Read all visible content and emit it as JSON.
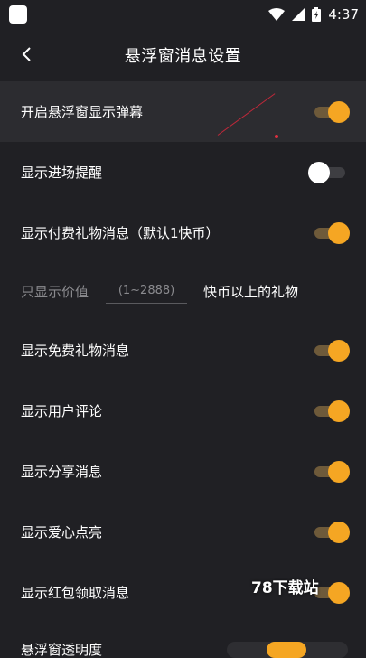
{
  "status_bar": {
    "time": "4:37"
  },
  "header": {
    "title": "悬浮窗消息设置"
  },
  "settings": [
    {
      "label": "开启悬浮窗显示弹幕",
      "on": true
    },
    {
      "label": "显示进场提醒",
      "on": false
    },
    {
      "label": "显示付费礼物消息（默认1快币）",
      "on": true
    }
  ],
  "value_filter": {
    "prefix": "只显示价值",
    "placeholder": "(1~2888)",
    "suffix": "快币以上的礼物"
  },
  "settings_more": [
    {
      "label": "显示免费礼物消息",
      "on": true
    },
    {
      "label": "显示用户评论",
      "on": true
    },
    {
      "label": "显示分享消息",
      "on": true
    },
    {
      "label": "显示爱心点亮",
      "on": true
    },
    {
      "label": "显示红包领取消息",
      "on": true
    }
  ],
  "bottom_row": {
    "label": "悬浮窗透明度"
  },
  "watermark": "78下载站",
  "colors": {
    "accent": "#f5a623",
    "background": "#202024",
    "highlight": "#2c2c30"
  }
}
